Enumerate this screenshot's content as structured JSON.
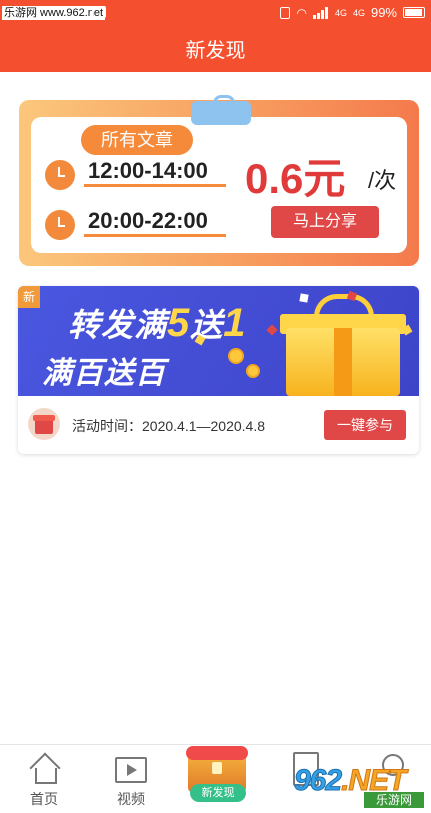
{
  "status_bar": {
    "watermark": "乐游网 www.962.net",
    "network_1": "4G",
    "network_2": "4G",
    "battery": "99%"
  },
  "header": {
    "title": "新发现"
  },
  "reward_card": {
    "tag": "所有文章",
    "time_slots": [
      "12:00-14:00",
      "20:00-22:00"
    ],
    "price": "0.6元",
    "unit": "/次",
    "share_button": "马上分享",
    "accent": "#e03a3a"
  },
  "promo_card": {
    "new_tag": "新",
    "headline_prefix": "转发满",
    "headline_num1": "5",
    "headline_mid": "送",
    "headline_num2": "1",
    "subline": "满百送百",
    "activity_time": "活动时间：2020.4.1—2020.4.8",
    "join_button": "一键参与",
    "banner_color": "#4a57e0"
  },
  "tab_bar": {
    "tabs": [
      {
        "label": "首页",
        "icon": "home-icon"
      },
      {
        "label": "视频",
        "icon": "video-icon"
      },
      {
        "label": "新发现",
        "icon": "treasure-chest-icon"
      },
      {
        "label": "",
        "icon": "document-icon"
      },
      {
        "label": "",
        "icon": "search-icon"
      }
    ]
  },
  "watermark_logo": {
    "big_a": "962",
    "big_b": ".NET",
    "small": "乐游网"
  }
}
